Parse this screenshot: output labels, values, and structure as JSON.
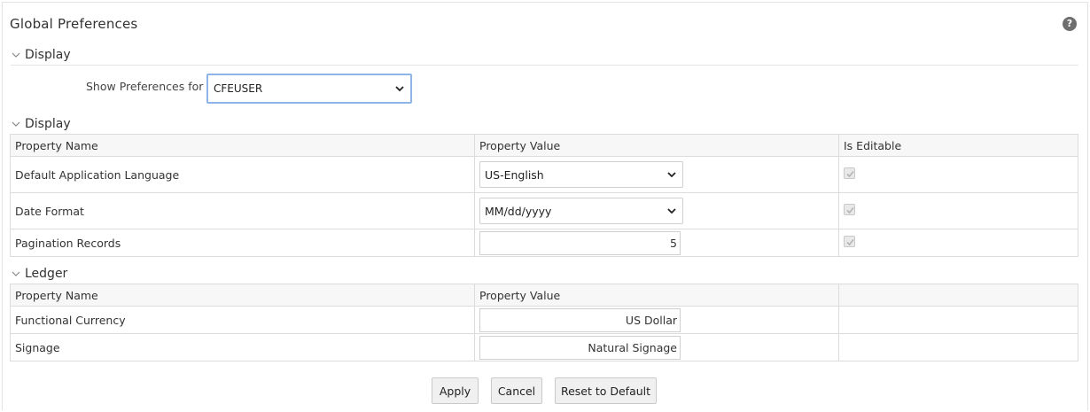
{
  "page": {
    "title": "Global Preferences"
  },
  "display_filter": {
    "section_title": "Display",
    "label": "Show Preferences for",
    "selected": "CFEUSER"
  },
  "display_table": {
    "section_title": "Display",
    "columns": [
      "Property Name",
      "Property Value",
      "Is Editable"
    ],
    "rows": [
      {
        "name": "Default Application Language",
        "value": "US-English",
        "control": "select",
        "editable": true
      },
      {
        "name": "Date Format",
        "value": "MM/dd/yyyy",
        "control": "select",
        "editable": true
      },
      {
        "name": "Pagination Records",
        "value": "5",
        "control": "input",
        "editable": true
      }
    ]
  },
  "ledger_table": {
    "section_title": "Ledger",
    "columns": [
      "Property Name",
      "Property Value",
      ""
    ],
    "rows": [
      {
        "name": "Functional Currency",
        "value": "US Dollar"
      },
      {
        "name": "Signage",
        "value": "Natural Signage"
      }
    ]
  },
  "buttons": {
    "apply": "Apply",
    "cancel": "Cancel",
    "reset": "Reset to Default"
  },
  "icons": {
    "help": "question-circle-icon",
    "section_toggle": "chevron-down-icon",
    "dropdown": "chevron-down-icon",
    "checkbox": "checkmark-icon"
  },
  "colors": {
    "focus_border": "#8fb5e8",
    "header_bg": "#f7f7f7",
    "grid_border": "#dcdcdc"
  }
}
